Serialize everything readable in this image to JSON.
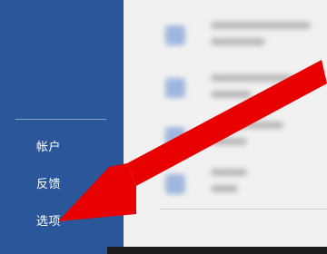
{
  "sidebar": {
    "items": [
      {
        "label": "帐户"
      },
      {
        "label": "反馈"
      },
      {
        "label": "选项"
      }
    ]
  },
  "colors": {
    "sidebar_bg": "#2b579a",
    "arrow": "#e80000"
  },
  "icons": [
    "red-pointer-arrow"
  ]
}
